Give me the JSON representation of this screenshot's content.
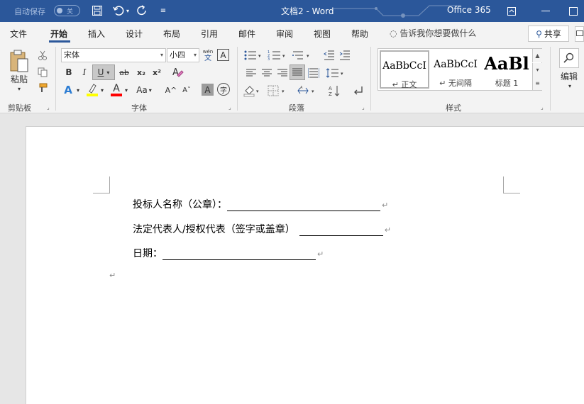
{
  "titlebar": {
    "autosave_label": "自动保存",
    "autosave_state": "关",
    "doc_title": "文档2  -  Word",
    "product": "Office 365",
    "icons": [
      "save-icon",
      "undo-icon",
      "redo-icon",
      "customize-qat-icon",
      "ribbon-display-icon",
      "minimize-icon"
    ]
  },
  "menu": {
    "tabs": [
      "文件",
      "开始",
      "插入",
      "设计",
      "布局",
      "引用",
      "邮件",
      "审阅",
      "视图",
      "帮助"
    ],
    "active_tab": "开始",
    "tell_me": "告诉我你想要做什么",
    "share": "共享"
  },
  "ribbon": {
    "clipboard": {
      "paste": "粘贴",
      "label": "剪贴板"
    },
    "font": {
      "font_name": "宋体",
      "font_size": "小四",
      "phonetic": "wén",
      "phonetic_char": "文",
      "border_char": "A",
      "label": "字体",
      "buttons": {
        "bold": "B",
        "italic": "I",
        "underline": "U",
        "strike": "ab",
        "subscript": "x₂",
        "superscript": "x²",
        "text_effect": "A",
        "font_color": "A",
        "change_case": "Aa",
        "grow": "A^",
        "shrink": "Aˇ",
        "char_shading": "A",
        "enclose": "字"
      }
    },
    "paragraph": {
      "label": "段落"
    },
    "styles": {
      "label": "样式",
      "items": [
        {
          "sample": "AaBbCcI",
          "name": "↵ 正文"
        },
        {
          "sample": "AaBbCcI",
          "name": "↵ 无间隔"
        },
        {
          "sample": "AaBl",
          "name": "标题 1"
        }
      ]
    },
    "editing": {
      "label": "编辑"
    }
  },
  "document": {
    "lines": [
      {
        "text": "投标人名称（公章）："
      },
      {
        "text": "法定代表人/授权代表（签字或盖章）"
      },
      {
        "text": "日期："
      }
    ],
    "para_mark": "↵"
  },
  "colors": {
    "accent": "#2b579a",
    "highlight": "#ffff00",
    "font_color": "#ff0000"
  }
}
